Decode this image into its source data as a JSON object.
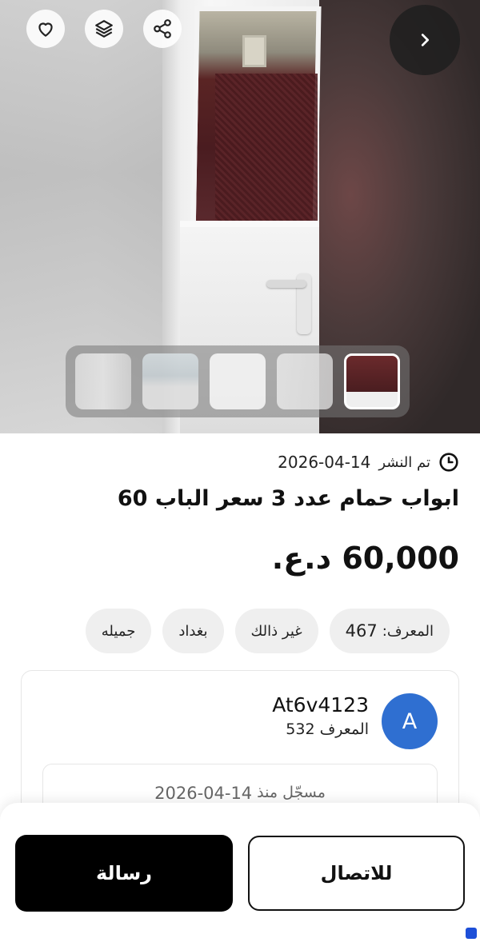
{
  "listing": {
    "posted_label": "تم النشر",
    "posted_date": "2026-04-14",
    "title": "ابواب حمام عدد 3 سعر الباب 60",
    "price_amount": "60,000",
    "price_currency": "د.ع."
  },
  "chips": [
    {
      "label": "المعرف:",
      "value": "467"
    },
    {
      "label": "غير ذالك"
    },
    {
      "label": "بغداد"
    },
    {
      "label": "جميله"
    }
  ],
  "seller": {
    "avatar_letter": "A",
    "name": "At6v4123",
    "id_label": "المعرف",
    "id_value": "532",
    "member_label": "مسجّل منذ",
    "member_date": "2026-04-14"
  },
  "actions": {
    "message_label": "رسالة",
    "call_label": "للاتصال"
  },
  "icons": {
    "favorite": "heart-icon",
    "layers": "layers-icon",
    "share": "share-icon",
    "next": "chevron-right-icon",
    "clock": "clock-icon"
  },
  "colors": {
    "avatar": "#2f6fd1",
    "primary_button": "#000000",
    "chip_bg": "#efefef"
  }
}
